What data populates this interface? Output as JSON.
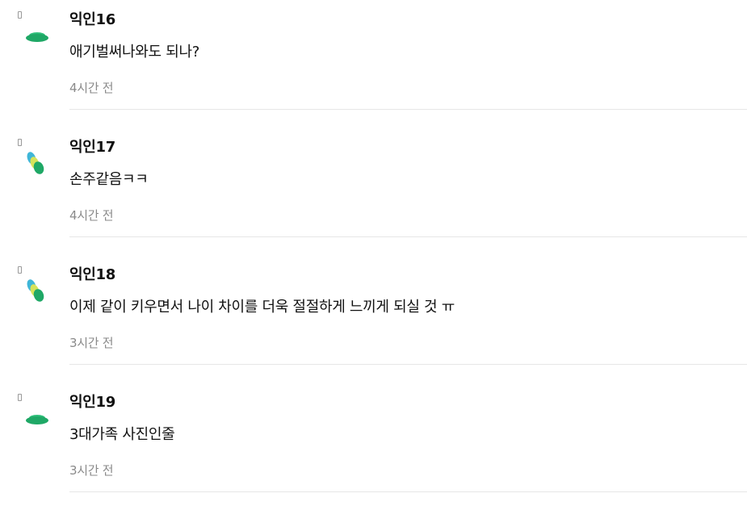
{
  "comments": [
    {
      "author": "익인16",
      "text": "애기벌써나와도 되나?",
      "time": "4시간 전",
      "avatar": "green-lily-pad-icon"
    },
    {
      "author": "익인17",
      "text": "손주같음ㅋㅋ",
      "time": "4시간 전",
      "avatar": "beads-icon"
    },
    {
      "author": "익인18",
      "text": "이제 같이 키우면서 나이 차이를 더욱 절절하게 느끼게 되실 것 ㅠ",
      "time": "3시간 전",
      "avatar": "beads-icon"
    },
    {
      "author": "익인19",
      "text": "3대가족 사진인줄",
      "time": "3시간 전",
      "avatar": "green-lily-pad-icon"
    }
  ],
  "colors": {
    "avatar_green": "#2fbf7a",
    "avatar_teal": "#3fb6d8",
    "avatar_yellow": "#d7e35a"
  }
}
